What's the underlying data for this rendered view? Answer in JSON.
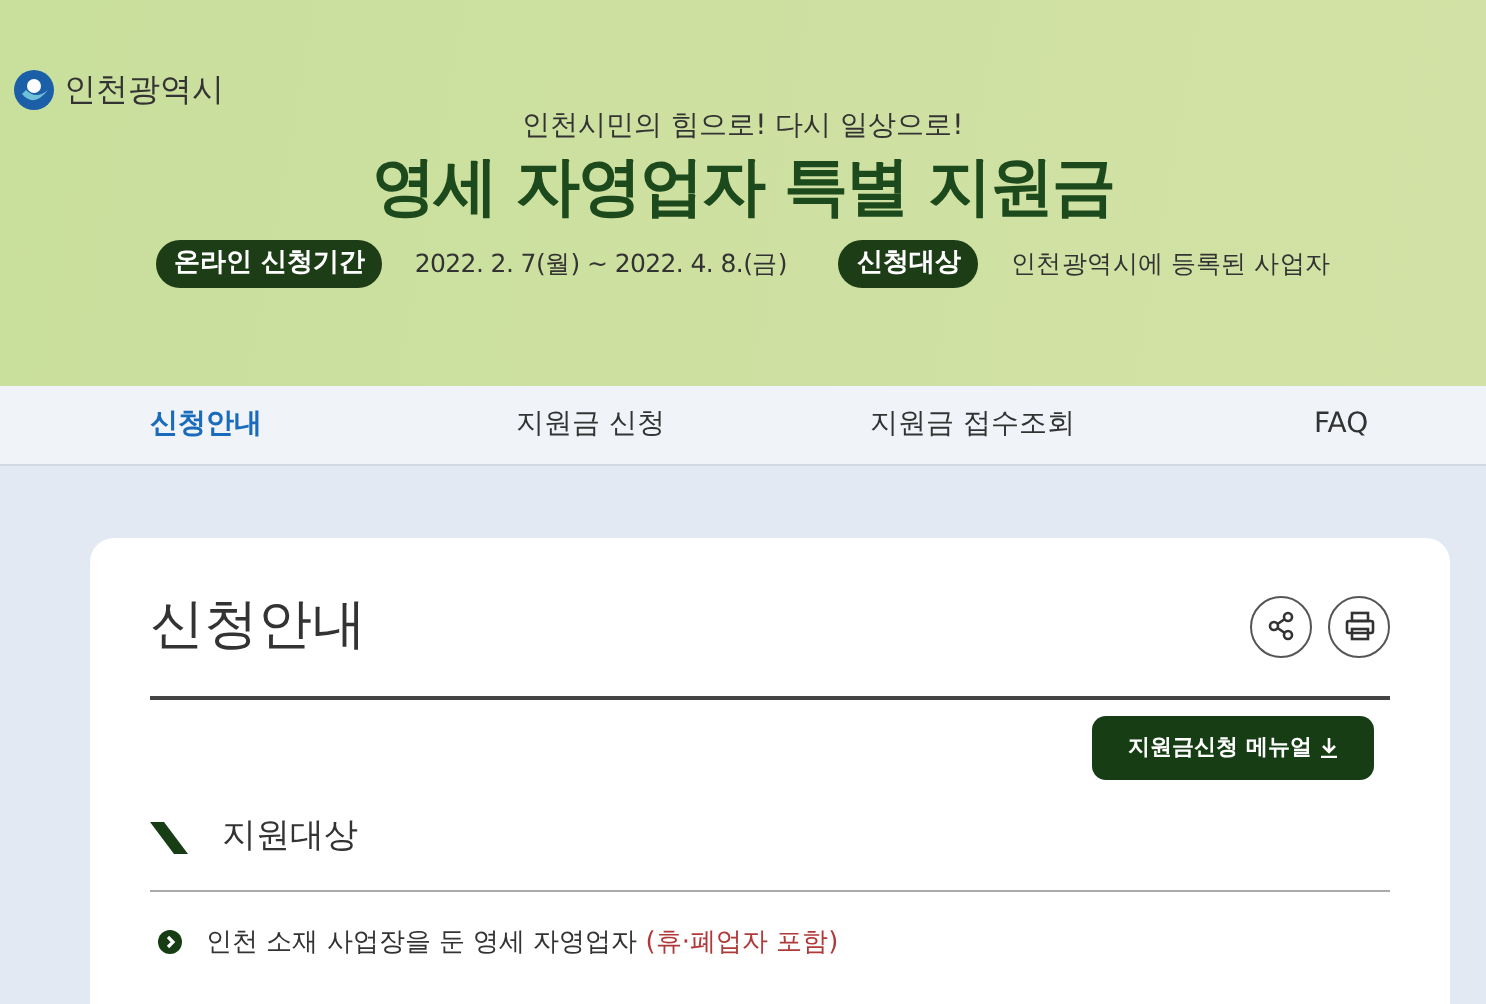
{
  "logo": {
    "text": "인천광역시"
  },
  "banner": {
    "slogan": "인천시민의 힘으로! 다시 일상으로!",
    "title": "영세 자영업자 특별 지원금",
    "info": [
      {
        "tag": "온라인 신청기간",
        "text": "2022. 2. 7(월) ~ 2022. 4. 8.(금)"
      },
      {
        "tag": "신청대상",
        "text": "인천광역시에 등록된 사업자"
      }
    ]
  },
  "nav": [
    {
      "label": "신청안내",
      "selected": true
    },
    {
      "label": "지원금 신청",
      "selected": false
    },
    {
      "label": "지원금 접수조회",
      "selected": false
    },
    {
      "label": "FAQ",
      "selected": false
    }
  ],
  "page": {
    "title": "신청안내",
    "manual_button": "지원금신청 메뉴얼",
    "section": {
      "heading": "지원대상",
      "items": [
        {
          "text": "인천 소재 사업장을 둔 영세 자영업자 ",
          "note": "(휴·폐업자 포함)"
        }
      ]
    }
  }
}
